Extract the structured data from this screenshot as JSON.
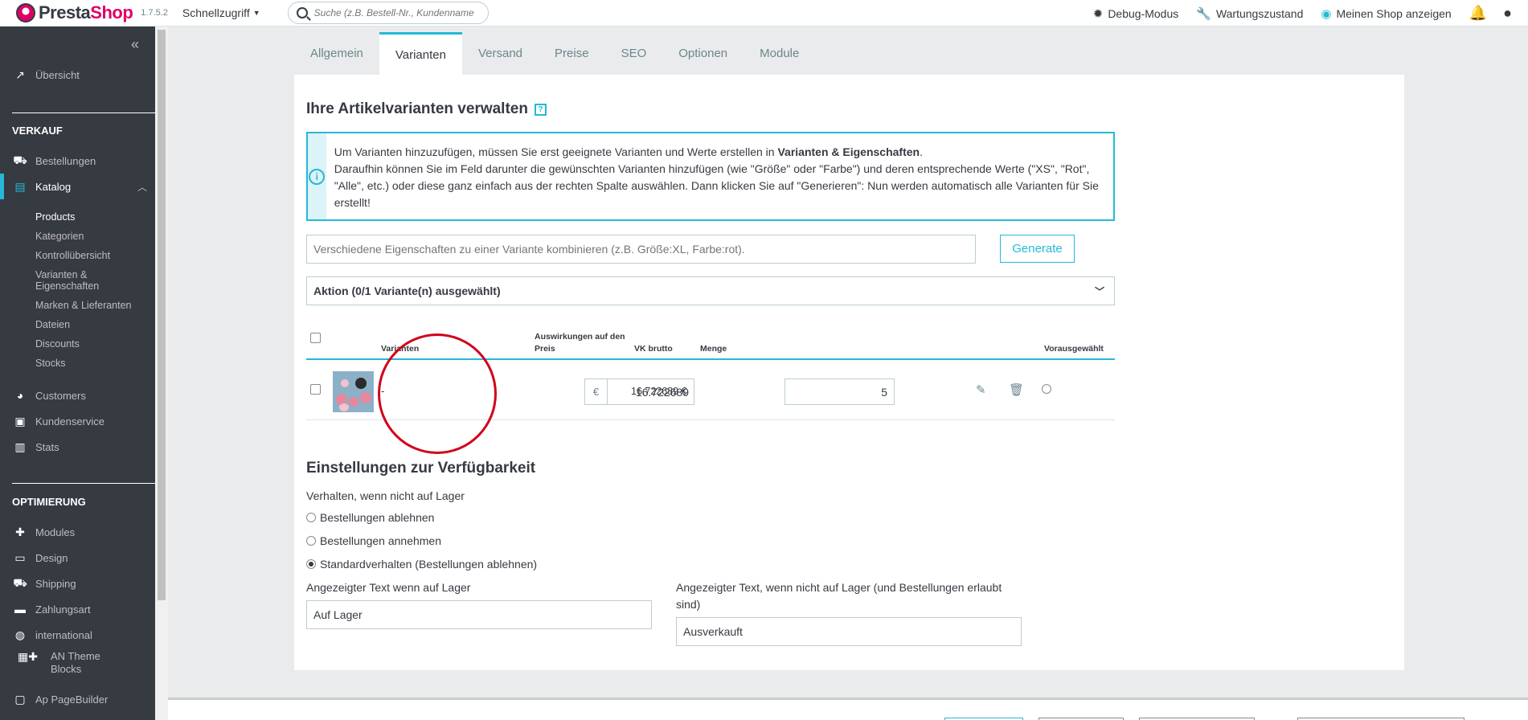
{
  "header": {
    "brand_presta": "Presta",
    "brand_shop": "Shop",
    "version": "1.7.5.2",
    "quick_access": "Schnellzugriff",
    "search_placeholder": "Suche (z.B. Bestell-Nr., Kundenname ...)",
    "debug_mode": "Debug-Modus",
    "maintenance": "Wartungszustand",
    "view_shop": "Meinen Shop anzeigen"
  },
  "sidebar": {
    "overview": "Übersicht",
    "section_sell": "VERKAUF",
    "orders": "Bestellungen",
    "catalog": "Katalog",
    "catalog_sub": {
      "products": "Products",
      "categories": "Kategorien",
      "monitoring": "Kontrollübersicht",
      "attributes": "Varianten & Eigenschaften",
      "brands": "Marken & Lieferanten",
      "files": "Dateien",
      "discounts": "Discounts",
      "stocks": "Stocks"
    },
    "customers": "Customers",
    "customer_service": "Kundenservice",
    "stats": "Stats",
    "section_improve": "OPTIMIERUNG",
    "modules": "Modules",
    "design": "Design",
    "shipping": "Shipping",
    "payment": "Zahlungsart",
    "international": "international",
    "an_theme_blocks": "AN Theme Blocks",
    "ap_pagebuilder": "Ap PageBuilder"
  },
  "tabs": [
    "Allgemein",
    "Varianten",
    "Versand",
    "Preise",
    "SEO",
    "Optionen",
    "Module"
  ],
  "combinations": {
    "title": "Ihre Artikelvarianten verwalten",
    "help": "?",
    "alert_line1_pre": "Um Varianten hinzuzufügen, müssen Sie erst geeignete Varianten und Werte erstellen in ",
    "alert_line1_bold": "Varianten & Eigenschaften",
    "alert_line1_post": ".",
    "alert_line2": "Daraufhin können Sie im Feld darunter die gewünschten Varianten hinzufügen (wie \"Größe\" oder \"Farbe\") und deren entsprechende Werte (\"XS\", \"Rot\", \"Alle\", etc.) oder diese ganz einfach aus der rechten Spalte auswählen. Dann klicken Sie auf \"Generieren\": Nun werden automatisch alle Varianten für Sie erstellt!",
    "input_placeholder": "Verschiedene Eigenschaften zu einer Variante kombinieren (z.B. Größe:XL, Farbe:rot).",
    "generate_label": "Generate",
    "action_label": "Aktion (0/1 Variante(n) ausgewählt)",
    "columns": {
      "variants": "Varianten",
      "impact_price": "Auswirkungen auf den Preis",
      "price_gross": "VK brutto",
      "quantity": "Menge",
      "default": "Vorausgewählt"
    },
    "row": {
      "name": "-",
      "currency": "€",
      "impact_price": "16.722689",
      "price_gross": "16.722689 €",
      "quantity": "5"
    }
  },
  "availability": {
    "title": "Einstellungen zur Verfügbarkeit",
    "behavior_label": "Verhalten, wenn nicht auf Lager",
    "options": [
      "Bestellungen ablehnen",
      "Bestellungen annehmen",
      "Standardverhalten (Bestellungen ablehnen)"
    ],
    "selected_option": 2,
    "in_stock_label": "Angezeigter Text wenn auf Lager",
    "in_stock_value": "Auf Lager",
    "out_stock_label": "Angezeigter Text, wenn nicht auf Lager (und Bestellungen erlaubt sind)",
    "out_stock_value": "Ausverkauft"
  },
  "colors": {
    "accent": "#25b9d7",
    "sidebar": "#363a41",
    "annotation": "#d0021b",
    "brand": "#df0067"
  }
}
